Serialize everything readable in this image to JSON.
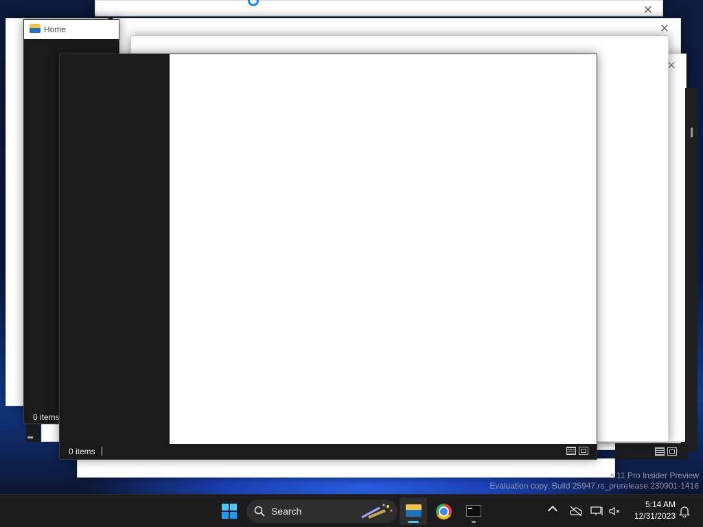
{
  "desktop": {
    "watermark_line1": "s 11 Pro Insider Preview",
    "watermark_line2": "Evaluation copy. Build 25947.rs_prerelease.230901-1416"
  },
  "windows": {
    "home": {
      "title": "Home",
      "status": "0 items"
    },
    "front": {
      "status": "0 items"
    }
  },
  "taskbar": {
    "search_label": "Search",
    "apps": [
      "start-icon",
      "file-explorer-icon",
      "chrome-icon",
      "terminal-icon"
    ],
    "clock_time": "5:14 AM",
    "clock_date": "12/31/2023"
  },
  "colors": {
    "accent": "#0a84ff",
    "explorer_folder": "#f5c242",
    "sidebar_dark": "#1a1a1a",
    "taskbar": "#1c1c1c"
  }
}
